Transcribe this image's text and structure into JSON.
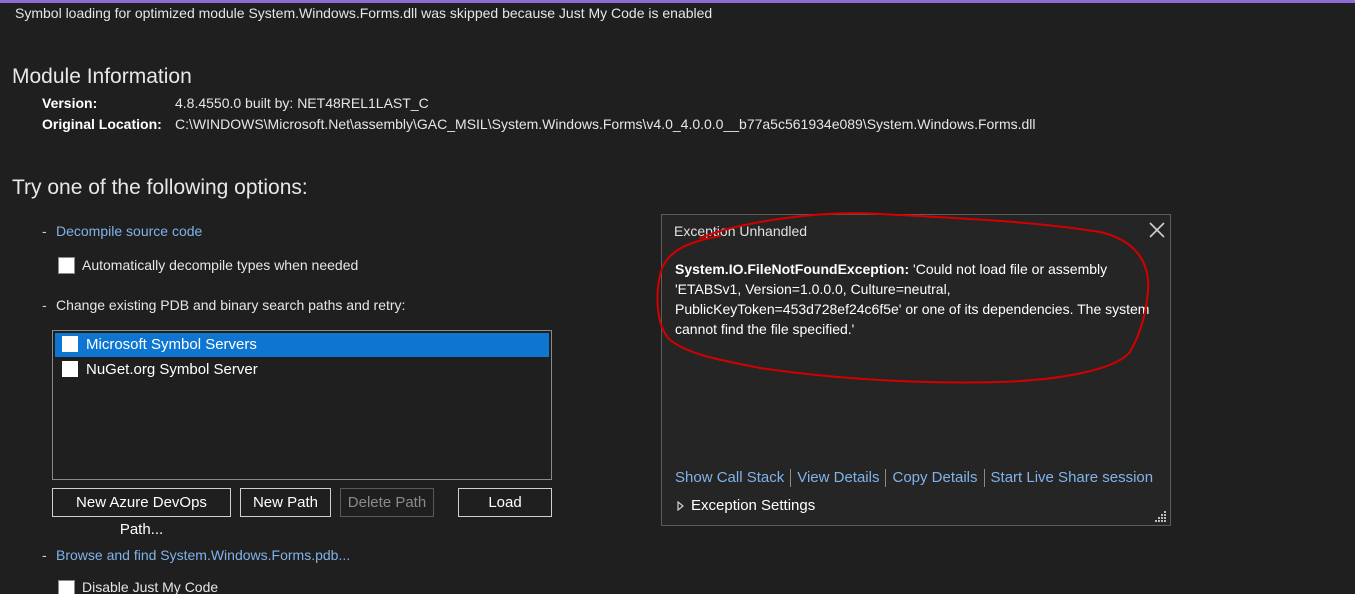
{
  "banner": {
    "text": "Symbol loading for optimized module System.Windows.Forms.dll was skipped because Just My Code is enabled"
  },
  "module_info": {
    "heading": "Module Information",
    "version_label": "Version:",
    "version_value": "4.8.4550.0 built by: NET48REL1LAST_C",
    "location_label": "Original Location:",
    "location_value": "C:\\WINDOWS\\Microsoft.Net\\assembly\\GAC_MSIL\\System.Windows.Forms\\v4.0_4.0.0.0__b77a5c561934e089\\System.Windows.Forms.dll"
  },
  "options": {
    "heading": "Try one of the following options:",
    "dash": "-",
    "decompile_link": "Decompile source code",
    "auto_decompile_label": "Automatically decompile types when needed",
    "change_paths_text": "Change existing PDB and binary search paths and retry:",
    "symbol_servers": [
      {
        "label": "Microsoft Symbol Servers",
        "checked": false,
        "selected": true
      },
      {
        "label": "NuGet.org Symbol Server",
        "checked": false,
        "selected": false
      }
    ],
    "buttons": {
      "new_azure": "New Azure DevOps Path...",
      "new_path": "New Path",
      "delete_path": "Delete Path",
      "load": "Load"
    },
    "browse_link": "Browse and find System.Windows.Forms.pdb...",
    "disable_jmc_label": "Disable Just My Code"
  },
  "exception_popup": {
    "title": "Exception Unhandled",
    "exception_type": "System.IO.FileNotFoundException:",
    "message": " 'Could not load file or assembly 'ETABSv1, Version=1.0.0.0, Culture=neutral, PublicKeyToken=453d728ef24c6f5e' or one of its dependencies. The system cannot find the file specified.'",
    "links": {
      "show_call_stack": "Show Call Stack",
      "view_details": "View Details",
      "copy_details": "Copy Details",
      "start_live_share": "Start Live Share session"
    },
    "exception_settings": "Exception Settings"
  },
  "colors": {
    "background": "#1f1f1f",
    "link": "#7fb3ea",
    "selection": "#0e76d1",
    "accent": "#8f6bd6",
    "annotation": "#d40000"
  }
}
